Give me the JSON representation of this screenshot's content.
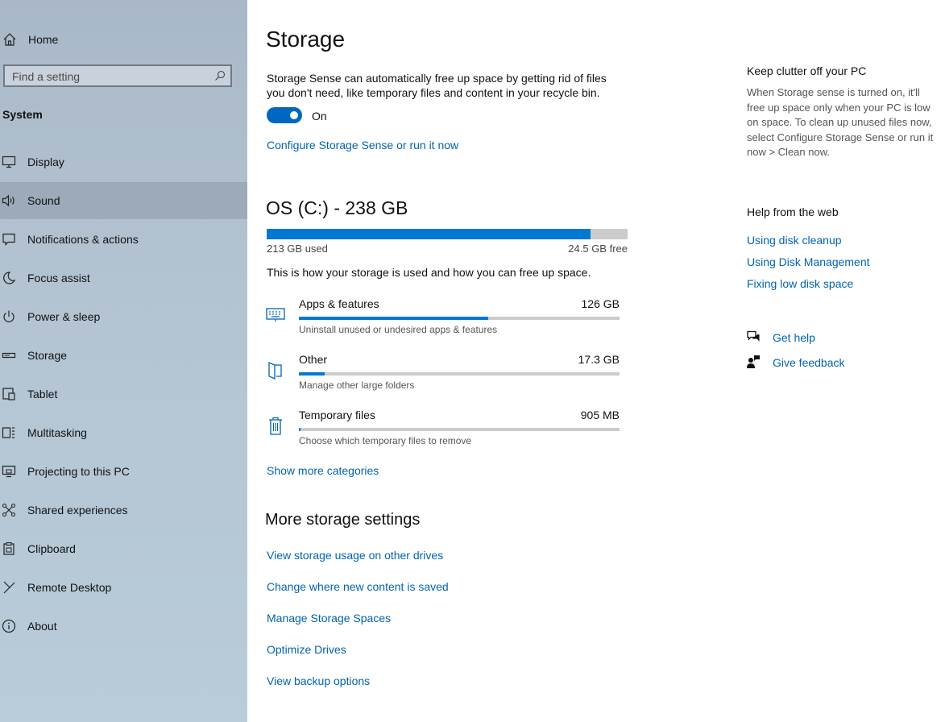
{
  "sidebar": {
    "home_label": "Home",
    "search_placeholder": "Find a setting",
    "section_label": "System",
    "items": [
      {
        "label": "Display",
        "icon": "display-icon"
      },
      {
        "label": "Sound",
        "icon": "speaker-icon",
        "active": true
      },
      {
        "label": "Notifications & actions",
        "icon": "notification-icon"
      },
      {
        "label": "Focus assist",
        "icon": "moon-icon"
      },
      {
        "label": "Power & sleep",
        "icon": "power-icon"
      },
      {
        "label": "Storage",
        "icon": "storage-icon"
      },
      {
        "label": "Tablet",
        "icon": "tablet-icon"
      },
      {
        "label": "Multitasking",
        "icon": "multitasking-icon"
      },
      {
        "label": "Projecting to this PC",
        "icon": "projecting-icon"
      },
      {
        "label": "Shared experiences",
        "icon": "shared-icon"
      },
      {
        "label": "Clipboard",
        "icon": "clipboard-icon"
      },
      {
        "label": "Remote Desktop",
        "icon": "remote-desktop-icon"
      },
      {
        "label": "About",
        "icon": "info-icon"
      }
    ]
  },
  "main": {
    "title": "Storage",
    "description": "Storage Sense can automatically free up space by getting rid of files you don't need, like temporary files and content in your recycle bin.",
    "toggle_label": "On",
    "toggle_on": true,
    "configure_link": "Configure Storage Sense or run it now",
    "drive": {
      "title": "OS (C:) - 238 GB",
      "used_label": "213 GB used",
      "free_label": "24.5 GB free",
      "used_fraction": 0.897
    },
    "usage_intro": "This is how your storage is used and how you can free up space.",
    "categories": [
      {
        "name": "Apps & features",
        "size": "126 GB",
        "sub": "Uninstall unused or undesired apps & features",
        "fraction": 0.59,
        "icon": "keyboard-icon"
      },
      {
        "name": "Other",
        "size": "17.3 GB",
        "sub": "Manage other large folders",
        "fraction": 0.08,
        "icon": "folder-icon"
      },
      {
        "name": "Temporary files",
        "size": "905 MB",
        "sub": "Choose which temporary files to remove",
        "fraction": 0.005,
        "icon": "trash-icon"
      }
    ],
    "show_more": "Show more categories",
    "more_heading": "More storage settings",
    "more_links": [
      "View storage usage on other drives",
      "Change where new content is saved",
      "Manage Storage Spaces",
      "Optimize Drives",
      "View backup options"
    ]
  },
  "right": {
    "clutter_heading": "Keep clutter off your PC",
    "clutter_text": "When Storage sense is turned on, it'll free up space only when your PC is low on space. To clean up unused files now, select Configure Storage Sense or run it now > Clean now.",
    "help_heading": "Help from the web",
    "help_links": [
      "Using disk cleanup",
      "Using Disk Management",
      "Fixing low disk space"
    ],
    "get_help": "Get help",
    "give_feedback": "Give feedback"
  },
  "colors": {
    "accent": "#0078d4",
    "link": "#0063b1",
    "toggle": "#0067c0"
  }
}
